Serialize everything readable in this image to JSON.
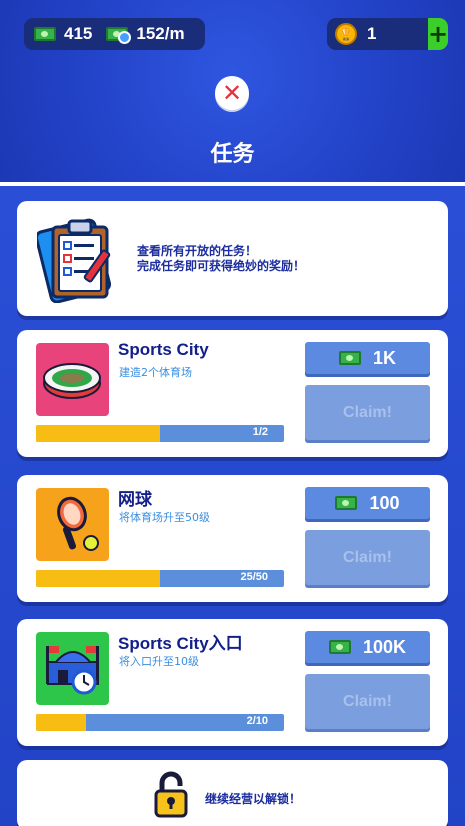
{
  "header": {
    "cash": "415",
    "income_rate": "152/m",
    "trophies": "1",
    "plus_label": "+",
    "close_symbol": "✕",
    "title": "任务"
  },
  "intro": {
    "icon": "clipboard-checklist-icon",
    "line1": "查看所有开放的任务！",
    "line2": "完成任务即可获得绝妙的奖励！"
  },
  "quests": [
    {
      "name": "Sports City",
      "description": "建造2个体育场",
      "icon": "stadium-icon",
      "progress_text": "1/2",
      "progress_fraction": 0.5,
      "reward": "1K",
      "claim_label": "Claim!"
    },
    {
      "name": "网球",
      "description": "将体育场升至50级",
      "icon": "tennis-racket-icon",
      "progress_text": "25/50",
      "progress_fraction": 0.5,
      "reward": "100",
      "claim_label": "Claim!"
    },
    {
      "name": "Sports City入口",
      "description": "将入口升至10级",
      "icon": "entrance-gate-icon",
      "progress_text": "2/10",
      "progress_fraction": 0.2,
      "reward": "100K",
      "claim_label": "Claim!"
    }
  ],
  "locked": {
    "icon": "padlock-icon",
    "text": "继续经营以解锁！"
  },
  "colors": {
    "background": "#2446c9",
    "progress_fill": "#f7bd12",
    "progress_track": "#5c8fdb",
    "reward_button": "#5b8ae0",
    "claim_disabled": "#7b9ede",
    "quest_title": "#13208a",
    "quest_desc": "#3a8ee0",
    "close_red": "#e5323c",
    "plus_green": "#3ccf2c"
  }
}
